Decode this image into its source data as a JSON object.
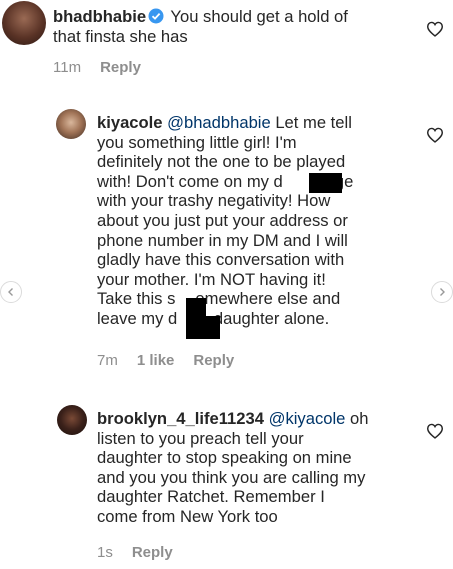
{
  "comments": [
    {
      "username": "bhadbhabie",
      "verified": true,
      "lines": [
        " You should get a hold of",
        "that finsta she has"
      ],
      "time": "11m",
      "reply": "Reply"
    },
    {
      "username": "kiyacole",
      "mention": "@bhadbhabie",
      "lines": [
        " Let me tell",
        "you something little girl! I'm",
        "definitely not the one to be played",
        "with! Don't come on my d",
        "with your trashy negativity! How",
        "about you just put your address or",
        "phone number in my DM and I will",
        "gladly have this conversation with",
        "your mother. I'm NOT having it!",
        "Take this s",
        "leave my d"
      ],
      "line4_tail": " page",
      "line10_tail": "omewhere else and",
      "line11_tail": " daughter alone.",
      "time": "7m",
      "likes": "1 like",
      "reply": "Reply"
    },
    {
      "username": "brooklyn_4_life11234",
      "mention": "@kiyacole",
      "lines": [
        " oh",
        "listen to you preach tell your",
        "daughter to stop speaking on mine",
        "and you you think you are calling my",
        "daughter Ratchet.  Remember I",
        "come from New York too"
      ],
      "time": "1s",
      "reply": "Reply"
    }
  ],
  "colors": {
    "text": "#262626",
    "meta": "#8e8e8e",
    "mention": "#003569",
    "verified": "#3897f0"
  }
}
